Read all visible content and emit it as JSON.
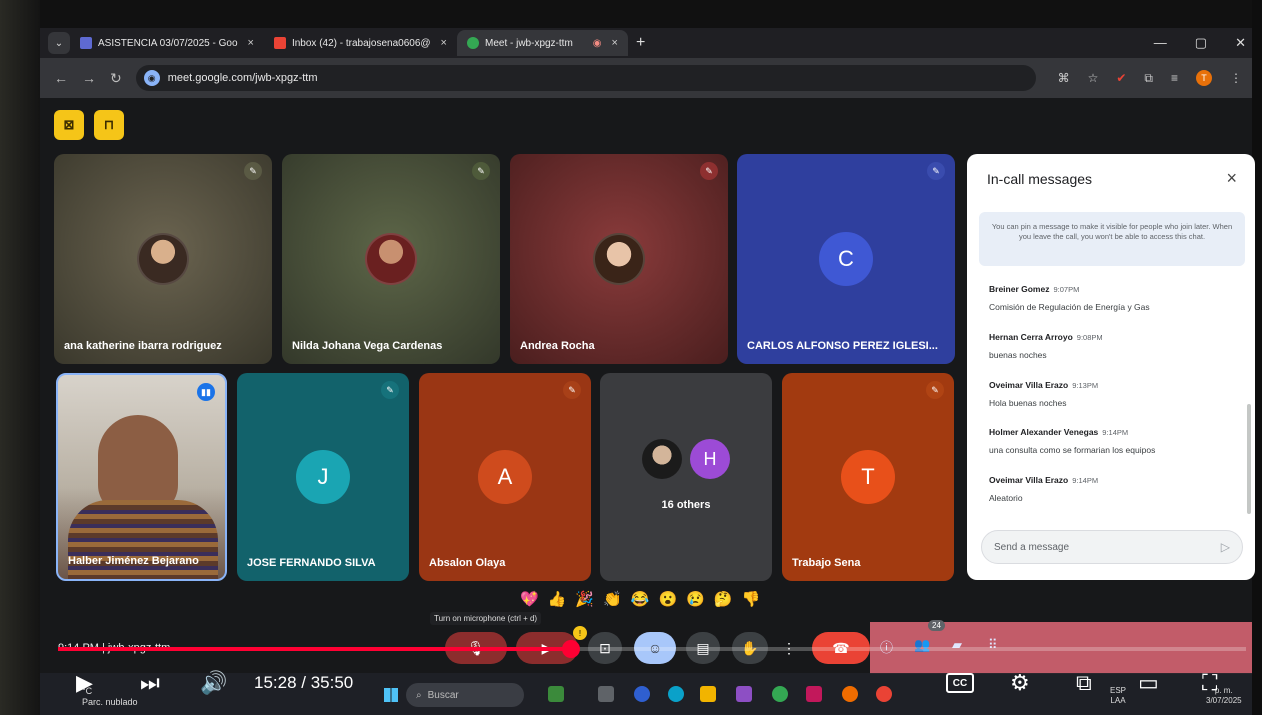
{
  "browser": {
    "tabs": [
      {
        "title": "ASISTENCIA 03/07/2025 - Goo",
        "close": "×",
        "color": "#5e6ad2"
      },
      {
        "title": "Inbox (42) - trabajosena0606@",
        "close": "×",
        "color": "#ea4335"
      },
      {
        "title": "Meet - jwb-xpgz-ttm",
        "close": "×",
        "color": "#34a853",
        "active": true
      }
    ],
    "new_tab": "+",
    "url": "meet.google.com/jwb-xpgz-ttm",
    "profile_initial": "T"
  },
  "participants_top": [
    {
      "name": "ana katherine ibarra rodriguez",
      "type": "photo",
      "bg": "#4a4535"
    },
    {
      "name": "Nilda Johana Vega Cardenas",
      "type": "photo",
      "bg": "#3f4432"
    },
    {
      "name": "Andrea Rocha",
      "type": "photo",
      "bg": "#6e2b2b"
    },
    {
      "name": "CARLOS ALFONSO PEREZ IGLESI...",
      "type": "letter",
      "letter": "C",
      "bg": "#2f3f9e",
      "avatar": "#3f58d4"
    }
  ],
  "participants_bottom": [
    {
      "name": "Halber Jiménez Bejarano",
      "type": "video",
      "bg": "#c9c3b8"
    },
    {
      "name": "JOSE FERNANDO SILVA",
      "type": "letter",
      "letter": "J",
      "bg": "#12626b",
      "avatar": "#1aa5b3"
    },
    {
      "name": "Absalon Olaya",
      "type": "letter",
      "letter": "A",
      "bg": "#9a3614",
      "avatar": "#cf4b1d"
    },
    {
      "name": "16 others",
      "type": "others",
      "letter": "H",
      "bg": "#3b3c3f",
      "avatar": "#9c4bd6"
    },
    {
      "name": "Trabajo Sena",
      "type": "letter",
      "letter": "T",
      "bg": "#a23a10",
      "avatar": "#e8501a"
    }
  ],
  "chat": {
    "title": "In-call messages",
    "close": "×",
    "info": "You can pin a message to make it visible for people who join later. When you leave the call, you won't be able to access this chat.",
    "messages": [
      {
        "sender": "Breiner Gomez",
        "time": "9:07PM",
        "text": "Comisión de Regulación de Energía y Gas"
      },
      {
        "sender": "Hernan Cerra Arroyo",
        "time": "9:08PM",
        "text": "buenas noches"
      },
      {
        "sender": "Oveimar Villa Erazo",
        "time": "9:13PM",
        "text": "Hola buenas noches"
      },
      {
        "sender": "Holmer Alexander Venegas",
        "time": "9:14PM",
        "text": "una consulta como se formarian los equipos"
      },
      {
        "sender": "Oveimar Villa Erazo",
        "time": "9:14PM",
        "text": "Aleatorio"
      }
    ],
    "input_placeholder": "Send a message"
  },
  "meet_bar": {
    "time_code": "9:14 PM | jwb-xpgz-ttm",
    "tooltip": "Turn on microphone (ctrl + d)",
    "participant_count": "24",
    "reactions": [
      "💖",
      "👍",
      "🎉",
      "👏",
      "😂",
      "😮",
      "😢",
      "🤔",
      "👎"
    ]
  },
  "player": {
    "time": "15:28 / 35:50",
    "progress": 0.4316,
    "cc": "CC"
  },
  "taskbar": {
    "weather_temp": "°C",
    "weather_desc": "Parc. nublado",
    "search": "Buscar",
    "lang": "ESP",
    "lang2": "LAA",
    "clock": "p. m.",
    "date": "3/07/2025"
  },
  "colors": {
    "accent_red": "#ff0033",
    "meet_hangup": "#ea4335",
    "meet_yellow": "#f5c518"
  }
}
